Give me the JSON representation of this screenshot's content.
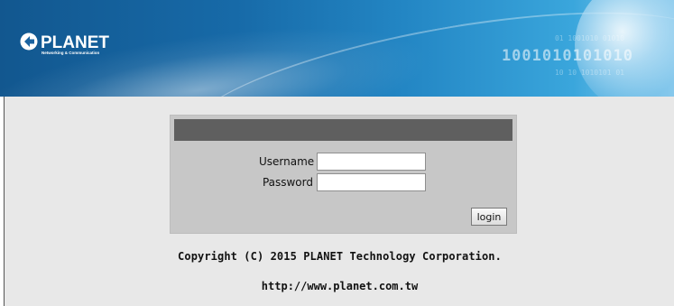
{
  "header": {
    "brand": "PLANET",
    "tagline": "Networking & Communication",
    "binary_main": "1001010101010",
    "binary_top": "01 1001010 01010",
    "binary_bottom": "10 10 1010101 01",
    "colors": {
      "banner_dark": "#12578f",
      "banner_light": "#8fcff0"
    }
  },
  "login": {
    "titlebar_color": "#5f5f5f",
    "username_label": "Username",
    "username_value": "",
    "password_label": "Password",
    "password_value": "",
    "login_button_label": "login"
  },
  "footer": {
    "copyright": "Copyright (C) 2015 PLANET Technology Corporation.",
    "url": "http://www.planet.com.tw"
  }
}
